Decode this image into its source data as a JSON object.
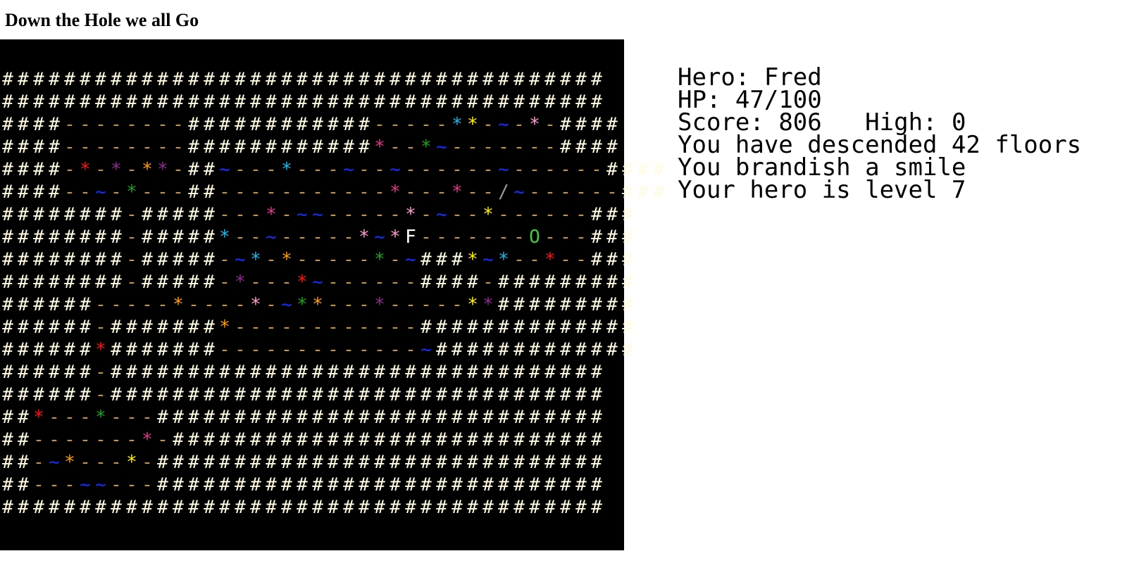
{
  "title": "Down the Hole we all Go",
  "hud": {
    "hero_label": "Hero:",
    "hero_name": "Fred",
    "hp_label": "HP:",
    "hp": "47/100",
    "score_label": "Score:",
    "score": "806",
    "high_label": "High:",
    "high": "0",
    "descended": "You have descended 42 floors",
    "weapon": "You brandish a smile",
    "level": "Your hero is level 7"
  },
  "map": {
    "background": "#000000",
    "colors": {
      "#": "#fffbe0",
      "-": "#c8962e",
      "~": "#1a2cff",
      "r": "#ff1010",
      "p": "#8e2a8e",
      "o": "#ff9d00",
      "g": "#1ea11e",
      "c": "#18b8f0",
      "y": "#ffee00",
      "k": "#ff9ccf",
      "m": "#e0338a",
      "/": "#9a9a9a",
      "F": "#ffffff",
      "O": "#3ccc3c",
      "Y": "#ffee00"
    },
    "rows": [
      "#######################################",
      "#######################################",
      "####--------############-----cy-~-k-####",
      "####--------############m--g~-------####",
      "####-r-p-op-##~---c---~--~------~------####",
      "####--~-g---##-----------m---m--/~------###",
      "########-#####---m-~~-----k-~--y------###",
      "########-#####c--~-----k~kF-------O---###",
      "########-#####-~c-o-----g-~###y~c--r--###",
      "########-#####-p---r~------####-#########",
      "######-----o----k-~go---p-----yp#########",
      "######-#######o------------##############",
      "######r#######-------------~#############",
      "######-################################",
      "######-################################",
      "##r---g---#############################",
      "##-------m-############################",
      "##-~o---y-#############################",
      "##---~~---#############################",
      "#######################################"
    ]
  }
}
